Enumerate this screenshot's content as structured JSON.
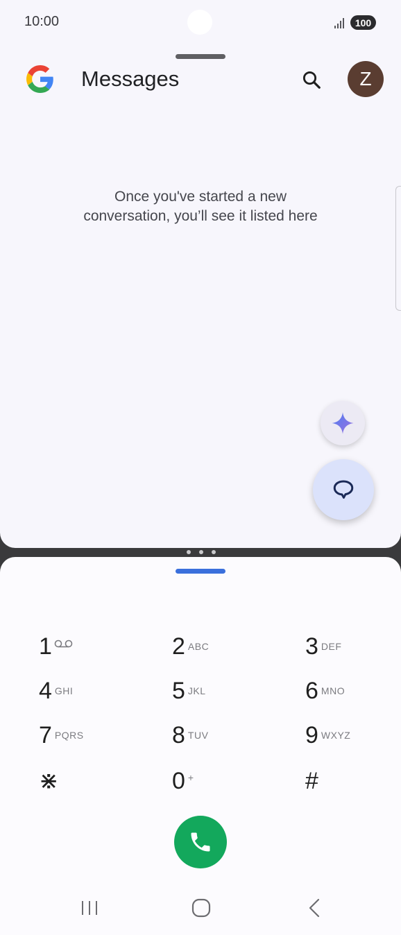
{
  "status_bar": {
    "time": "10:00",
    "battery": "100",
    "icons": [
      "signal-icon",
      "battery-icon"
    ]
  },
  "messages_app": {
    "title": "Messages",
    "avatar_letter": "Z",
    "empty_line1": "Once you've started a new",
    "empty_line2": "conversation, you’ll see it listed here",
    "icons": [
      "google-logo-icon",
      "search-icon",
      "sparkle-icon",
      "new-chat-icon"
    ]
  },
  "dialpad": {
    "keys": [
      {
        "digit": "1",
        "letters": "",
        "icon": "voicemail-icon"
      },
      {
        "digit": "2",
        "letters": "ABC"
      },
      {
        "digit": "3",
        "letters": "DEF"
      },
      {
        "digit": "4",
        "letters": "GHI"
      },
      {
        "digit": "5",
        "letters": "JKL"
      },
      {
        "digit": "6",
        "letters": "MNO"
      },
      {
        "digit": "7",
        "letters": "PQRS"
      },
      {
        "digit": "8",
        "letters": "TUV"
      },
      {
        "digit": "9",
        "letters": "WXYZ"
      },
      {
        "digit": "⋇",
        "letters": ""
      },
      {
        "digit": "0",
        "letters": "+"
      },
      {
        "digit": "#",
        "letters": ""
      }
    ],
    "call_icon": "phone-icon"
  },
  "nav_bar": {
    "icons": [
      "recents-icon",
      "home-icon",
      "back-icon"
    ]
  },
  "colors": {
    "call_green": "#13a85c",
    "accent_blue": "#3a6fdc",
    "avatar_brown": "#5a3d31",
    "compose_fab": "#dbe2fb"
  }
}
